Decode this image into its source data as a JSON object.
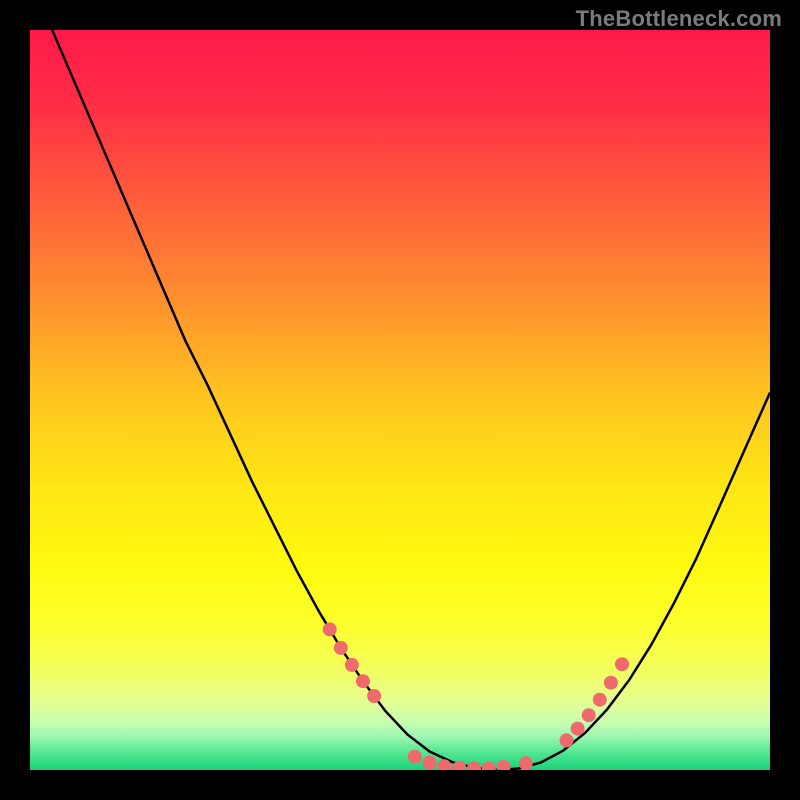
{
  "watermark": "TheBottleneck.com",
  "colors": {
    "page_bg": "#000000",
    "curve": "#000000",
    "marker": "#ef6a6c",
    "gradient_stops": [
      {
        "offset": 0.0,
        "color": "#ff1a4a"
      },
      {
        "offset": 0.1,
        "color": "#ff2d46"
      },
      {
        "offset": 0.22,
        "color": "#ff5a3c"
      },
      {
        "offset": 0.35,
        "color": "#ff8a30"
      },
      {
        "offset": 0.5,
        "color": "#ffc61f"
      },
      {
        "offset": 0.62,
        "color": "#ffe714"
      },
      {
        "offset": 0.72,
        "color": "#fff90f"
      },
      {
        "offset": 0.8,
        "color": "#fdff2a"
      },
      {
        "offset": 0.86,
        "color": "#f4ff59"
      },
      {
        "offset": 0.905,
        "color": "#e6ff8e"
      },
      {
        "offset": 0.935,
        "color": "#c8ffb0"
      },
      {
        "offset": 0.955,
        "color": "#9cf7b2"
      },
      {
        "offset": 0.975,
        "color": "#57e793"
      },
      {
        "offset": 1.0,
        "color": "#18d27a"
      }
    ]
  },
  "chart_data": {
    "type": "line",
    "title": "",
    "xlabel": "",
    "ylabel": "",
    "xlim": [
      0,
      100
    ],
    "ylim": [
      0,
      100
    ],
    "grid": false,
    "series": [
      {
        "name": "bottleneck-curve",
        "x": [
          0,
          3,
          6,
          9,
          12,
          15,
          18,
          21,
          24,
          27,
          30,
          33,
          36,
          39,
          42,
          45,
          48,
          51,
          54,
          57,
          60,
          63,
          66,
          69,
          72,
          75,
          78,
          81,
          84,
          87,
          90,
          93,
          96,
          100
        ],
        "y": [
          108,
          100,
          93,
          86,
          79,
          72,
          65,
          58,
          52,
          45.5,
          39,
          33,
          27,
          21.5,
          16.5,
          12,
          8,
          4.8,
          2.5,
          1.1,
          0.3,
          0.0,
          0.2,
          1.0,
          2.6,
          5.0,
          8.2,
          12.2,
          17.0,
          22.5,
          28.5,
          35.2,
          42.0,
          51.0
        ]
      }
    ],
    "markers": {
      "name": "highlighted-points",
      "x": [
        40.5,
        42.0,
        43.5,
        45.0,
        46.5,
        52.0,
        54.0,
        56.0,
        58.0,
        60.0,
        62.0,
        64.0,
        67.0,
        72.5,
        74.0,
        75.5,
        77.0,
        78.5,
        80.0
      ],
      "y": [
        19.0,
        16.5,
        14.2,
        12.0,
        10.0,
        1.8,
        1.0,
        0.5,
        0.3,
        0.2,
        0.2,
        0.4,
        0.9,
        4.0,
        5.6,
        7.4,
        9.5,
        11.8,
        14.3
      ]
    }
  }
}
